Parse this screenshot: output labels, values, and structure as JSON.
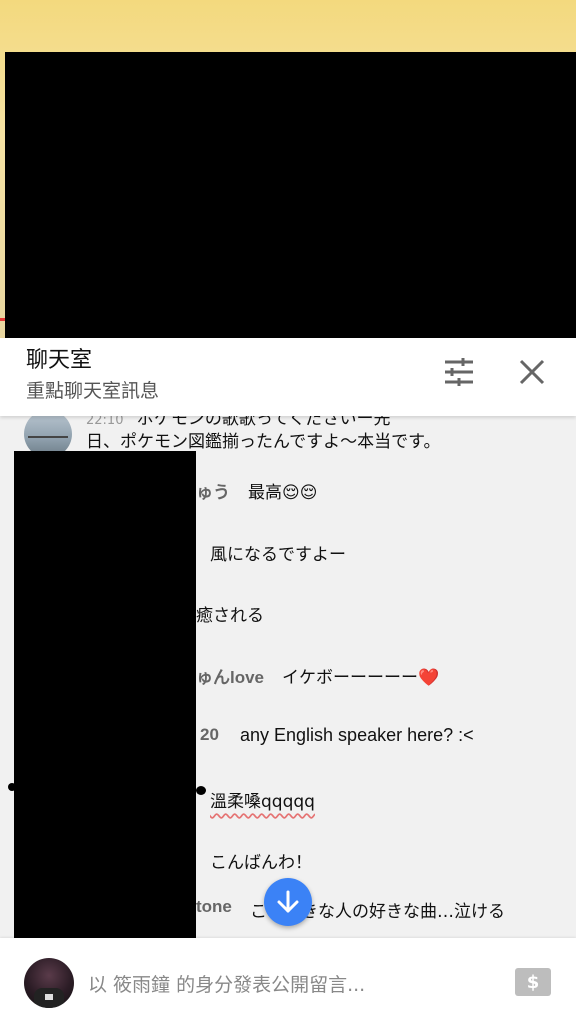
{
  "header": {
    "title": "聊天室",
    "subtitle": "重點聊天室訊息"
  },
  "messages": [
    {
      "time": "22:10",
      "text_line1": "ポケモンの歌歌ってくださいー先",
      "text_line2": "日、ポケモン図鑑揃ったんですよ〜本当です。"
    },
    {
      "author": "ゅう",
      "text": "最高😌😌"
    },
    {
      "author": "",
      "text": "風になるですよー"
    },
    {
      "author": "",
      "text": "癒される"
    },
    {
      "author": "ゅんlove",
      "text": "イケボーーーーー❤️"
    },
    {
      "author": "20",
      "text": "any English speaker here? :<"
    },
    {
      "author": "",
      "text": "溫柔嗓qqqqq"
    },
    {
      "author": "",
      "text": "こんばんわ！"
    },
    {
      "author": "tone",
      "text": "こ　好きな人の好きな曲…泣ける"
    }
  ],
  "composer": {
    "placeholder": "以 筱雨鐘 的身分發表公開留言...",
    "money_label": "$"
  },
  "colors": {
    "accent": "#3b82f6",
    "background": "#f1f1f1"
  },
  "icons": [
    "filter-icon",
    "close-icon",
    "arrow-down-icon",
    "super-chat-icon"
  ]
}
